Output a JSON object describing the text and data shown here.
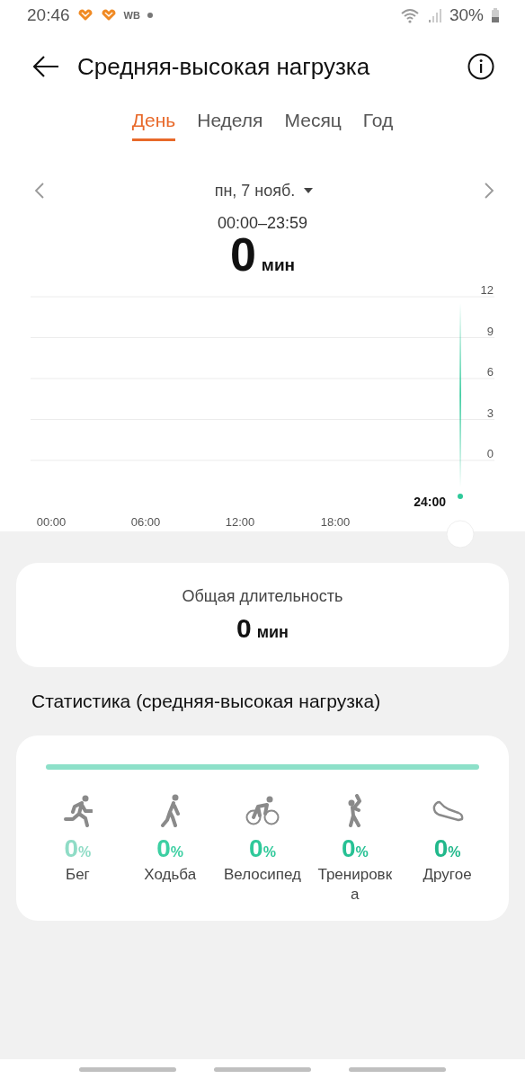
{
  "status_bar": {
    "time": "20:46",
    "badge": "WB",
    "battery": "30%"
  },
  "header": {
    "title": "Средняя-высокая нагрузка"
  },
  "tabs": [
    {
      "label": "День",
      "selected": true
    },
    {
      "label": "Неделя",
      "selected": false
    },
    {
      "label": "Месяц",
      "selected": false
    },
    {
      "label": "Год",
      "selected": false
    }
  ],
  "period": {
    "date": "пн, 7 нояб.",
    "range": "00:00–23:59",
    "value": "0",
    "unit": "мин"
  },
  "chart": {
    "y_ticks": [
      "12",
      "9",
      "6",
      "3",
      "0"
    ],
    "x_ticks": [
      "00:00",
      "06:00",
      "12:00",
      "18:00"
    ],
    "cursor_label": "24:00"
  },
  "total": {
    "label": "Общая длительность",
    "value": "0",
    "unit": "мин"
  },
  "stats": {
    "title": "Статистика (средняя-высокая нагрузка)",
    "activities": [
      {
        "kind": "run",
        "value": "0",
        "unit": "%",
        "label": "Бег",
        "color": "#8fdcc6"
      },
      {
        "kind": "walk",
        "value": "0",
        "unit": "%",
        "label": "Ходьба",
        "color": "#3ccfa2"
      },
      {
        "kind": "bike",
        "value": "0",
        "unit": "%",
        "label": "Велосипед",
        "color": "#2fc99a"
      },
      {
        "kind": "workout",
        "value": "0",
        "unit": "%",
        "label": "Тренировка",
        "color": "#27c194"
      },
      {
        "kind": "other",
        "value": "0",
        "unit": "%",
        "label": "Другое",
        "color": "#21b88b"
      }
    ]
  }
}
